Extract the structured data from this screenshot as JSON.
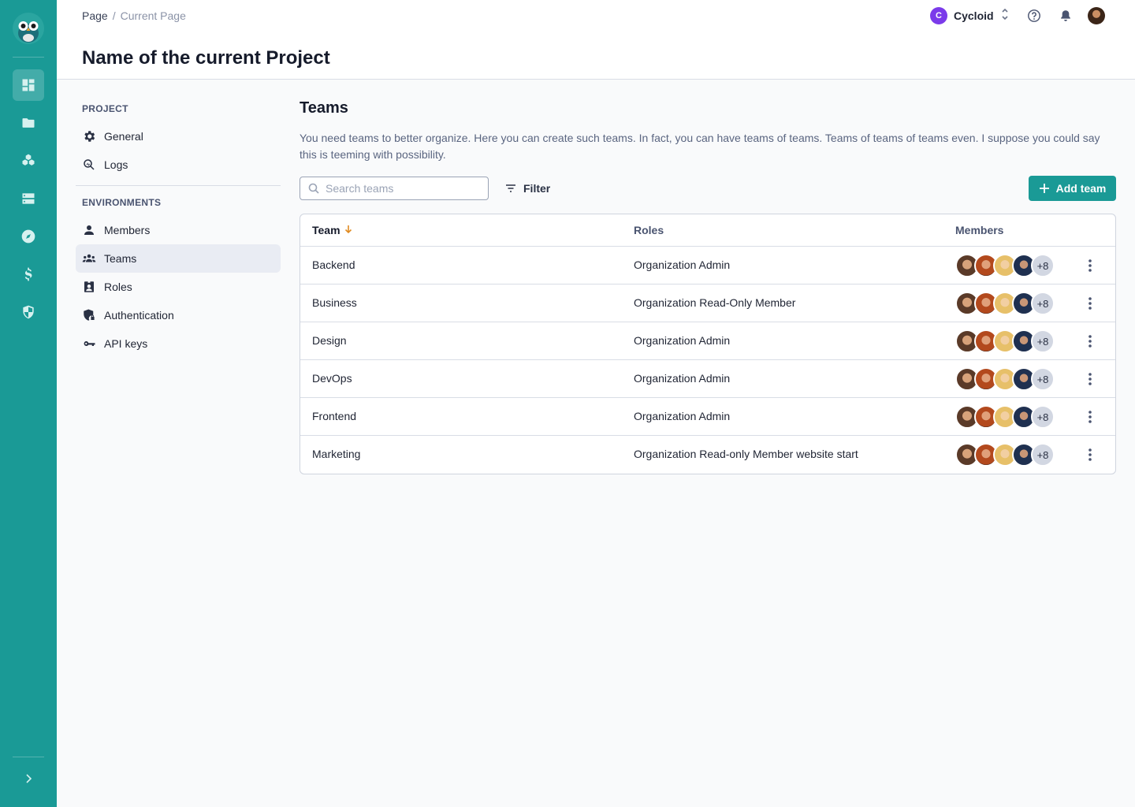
{
  "breadcrumb": {
    "root": "Page",
    "separator": "/",
    "current": "Current Page"
  },
  "page_title": "Name of the current Project",
  "org": {
    "initial": "C",
    "name": "Cycloid",
    "badge_color": "#7b3bea"
  },
  "header_icons": [
    "help-icon",
    "bell-icon",
    "user-avatar"
  ],
  "rail": {
    "accent": "#1a9a96",
    "items": [
      "dashboard-icon",
      "folder-icon",
      "stacks-icon",
      "servers-icon",
      "compass-icon",
      "dollar-icon",
      "shield-icon"
    ],
    "active": "dashboard-icon"
  },
  "subnav": {
    "project_label": "PROJECT",
    "project_items": [
      {
        "label": "General",
        "icon": "gear-icon"
      },
      {
        "label": "Logs",
        "icon": "logs-search-icon"
      }
    ],
    "environments_label": "ENVIRONMENTS",
    "environment_items": [
      {
        "label": "Members",
        "icon": "person-icon"
      },
      {
        "label": "Teams",
        "icon": "group-icon",
        "active": true
      },
      {
        "label": "Roles",
        "icon": "badge-icon"
      },
      {
        "label": "Authentication",
        "icon": "shield-lock-icon"
      },
      {
        "label": "API keys",
        "icon": "key-icon"
      }
    ]
  },
  "main": {
    "title": "Teams",
    "description": "You need teams to better organize. Here you can create such teams. In fact, you can have teams of teams. Teams of teams of teams even. I suppose you could say this is teeming with possibility.",
    "search_placeholder": "Search teams",
    "filter_label": "Filter",
    "add_label": "Add team"
  },
  "table": {
    "headers": {
      "team": "Team",
      "roles": "Roles",
      "members": "Members"
    },
    "rows": [
      {
        "team": "Backend",
        "role": "Organization Admin",
        "more": "+8"
      },
      {
        "team": "Business",
        "role": "Organization Read-Only Member",
        "more": "+8"
      },
      {
        "team": "Design",
        "role": "Organization Admin",
        "more": "+8"
      },
      {
        "team": "DevOps",
        "role": "Organization Admin",
        "more": "+8"
      },
      {
        "team": "Frontend",
        "role": "Organization Admin",
        "more": "+8"
      },
      {
        "team": "Marketing",
        "role": "Organization Read-only Member website start",
        "more": "+8"
      }
    ]
  }
}
